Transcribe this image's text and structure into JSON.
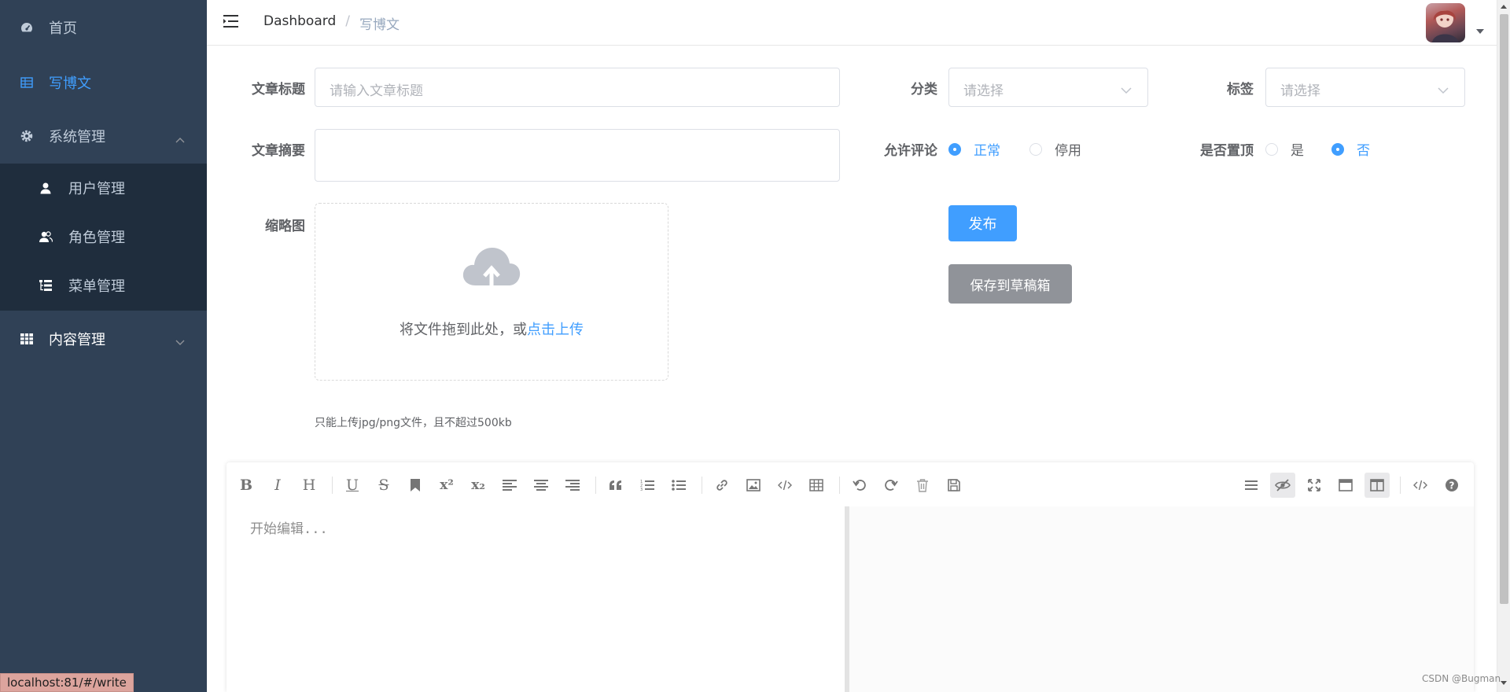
{
  "sidebar": {
    "items": [
      {
        "label": "首页",
        "icon": "dashboard-icon"
      },
      {
        "label": "写博文",
        "icon": "table-icon",
        "active": true
      },
      {
        "label": "系统管理",
        "icon": "gear-icon",
        "expanded": true
      },
      {
        "label": "内容管理",
        "icon": "grid-icon",
        "expanded": false
      }
    ],
    "sub_items": [
      {
        "label": "用户管理",
        "icon": "user-icon"
      },
      {
        "label": "角色管理",
        "icon": "users-icon"
      },
      {
        "label": "菜单管理",
        "icon": "tree-icon"
      }
    ]
  },
  "header": {
    "breadcrumb": [
      "Dashboard",
      "/",
      "写博文"
    ]
  },
  "form": {
    "title_label": "文章标题",
    "title_placeholder": "请输入文章标题",
    "category_label": "分类",
    "category_placeholder": "请选择",
    "tag_label": "标签",
    "tag_placeholder": "请选择",
    "summary_label": "文章摘要",
    "summary_value": "",
    "comment_label": "允许评论",
    "comment_options": [
      "正常",
      "停用"
    ],
    "comment_selected": "正常",
    "top_label": "是否置顶",
    "top_options": [
      "是",
      "否"
    ],
    "top_selected": "否",
    "thumb_label": "缩略图",
    "upload_text": "将文件拖到此处，或",
    "upload_link": "点击上传",
    "upload_tip": "只能上传jpg/png文件，且不超过500kb",
    "publish_button": "发布",
    "draft_button": "保存到草稿箱"
  },
  "editor": {
    "placeholder": "开始编辑...",
    "toolbar_left": [
      "bold-icon",
      "italic-icon",
      "header-icon",
      "underline-icon",
      "strikethrough-icon",
      "mark-icon",
      "superscript-icon",
      "subscript-icon",
      "align-left-icon",
      "align-center-icon",
      "align-right-icon",
      "quote-icon",
      "ordered-list-icon",
      "unordered-list-icon",
      "link-icon",
      "image-icon",
      "code-icon",
      "table-icon",
      "undo-icon",
      "redo-icon",
      "trash-icon",
      "save-icon"
    ],
    "toolbar_right": [
      "navigation-icon",
      "preview-toggle-icon",
      "fullscreen-icon",
      "read-mode-icon",
      "subfield-icon",
      "html-code-icon",
      "help-icon"
    ]
  },
  "status": {
    "url": "localhost:81/#/write",
    "watermark": "CSDN @Bugman"
  },
  "colors": {
    "sidebar_bg": "#304156",
    "sidebar_sub_bg": "#1f2d3d",
    "accent": "#409eff",
    "draft_button": "#909399"
  }
}
